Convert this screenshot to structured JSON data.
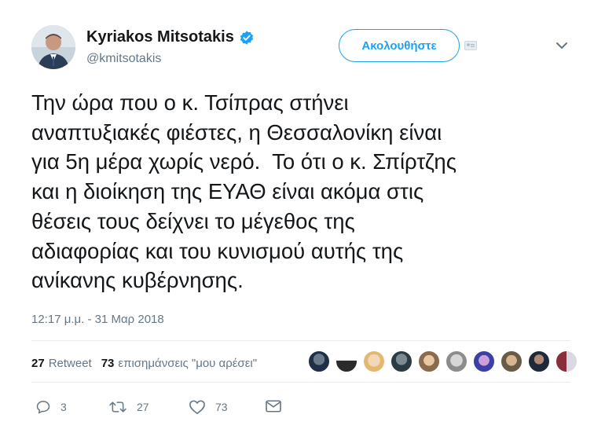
{
  "author": {
    "display_name": "Kyriakos Mitsotakis",
    "handle": "@kmitsotakis"
  },
  "follow_label": "Ακολουθήστε",
  "tweet": {
    "text": "Την ώρα που ο κ. Τσίπρας στήνει\nαναπτυξιακές φιέστες, η Θεσσαλονίκη είναι\nγια 5η μέρα χωρίς νερό.  Το ότι ο κ. Σπίρτζης\nκαι η διοίκηση της ΕΥΑΘ είναι ακόμα στις\nθέσεις τους δείχνει το μέγεθος της\nαδιαφορίας και του κυνισμού αυτής της\nανίκανης κυβέρνησης.",
    "timestamp": "12:17 μ.μ. - 31 Μαρ 2018"
  },
  "stats": {
    "retweet_count": "27",
    "retweet_label": "Retweet",
    "like_count": "73",
    "like_label": "επισημάνσεις \"μου αρέσει\""
  },
  "actions": {
    "reply_count": "3",
    "retweet_count": "27",
    "like_count": "73"
  },
  "colors": {
    "accent": "#1da1f2",
    "text": "#14171a",
    "muted": "#657786",
    "divider": "#e6ecf0"
  }
}
